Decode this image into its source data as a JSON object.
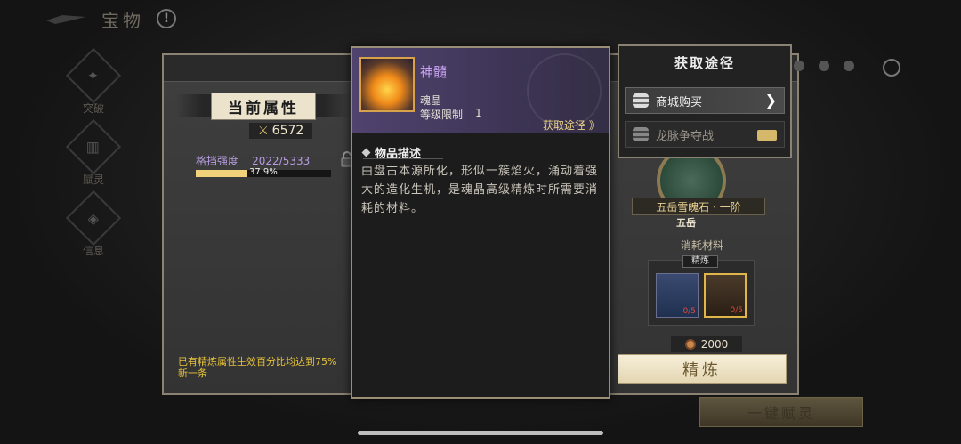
{
  "header": {
    "title": "宝物",
    "help": "!"
  },
  "nav": [
    {
      "label": "突破",
      "icon": "breakthrough-icon"
    },
    {
      "label": "赋灵",
      "icon": "infuse-icon"
    },
    {
      "label": "信息",
      "icon": "info-icon"
    }
  ],
  "attributes": {
    "header": "当前属性",
    "power": "6572",
    "stat": {
      "name": "格挡强度",
      "value": "2022/5333",
      "percent": "37.9%",
      "fill": 0.379
    },
    "note": "已有精炼属性生效百分比均达到75%",
    "note2": "新一条"
  },
  "craft": {
    "gem_name": "五岳雪魄石 · 一阶",
    "gem_sub": "五岳",
    "materials_title": "消耗材料",
    "materials_tag": "精炼",
    "slot1_count": "0/5",
    "slot2_count": "0/5",
    "cost": "2000",
    "refine_button": "精炼",
    "one_key_button": "一键赋灵"
  },
  "item_popup": {
    "name": "神髓",
    "type": "魂晶",
    "level_label": "等级限制",
    "level_value": "1",
    "get_link": "获取途径 》",
    "desc_title": "物品描述",
    "desc_text": "由盘古本源所化，形似一簇焰火，涌动着强大的造化生机，是魂晶高级精炼时所需要消耗的材料。"
  },
  "acquire": {
    "title": "获取途径",
    "items": [
      {
        "label": "商城购买",
        "chevron": "❯"
      },
      {
        "label": "龙脉争夺战"
      }
    ]
  }
}
